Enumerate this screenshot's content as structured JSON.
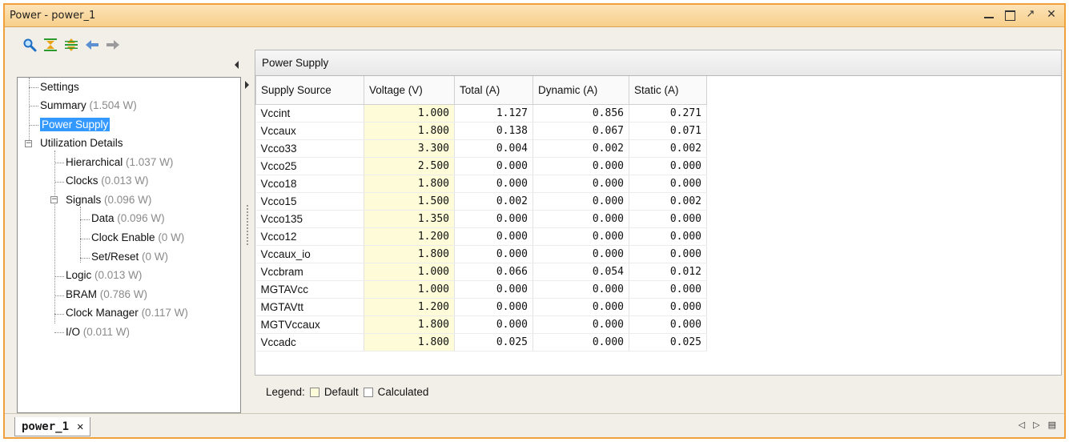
{
  "window": {
    "title": "Power - power_1",
    "minimize": "_",
    "float": "↗",
    "close": "✕"
  },
  "toolbar": {
    "icons": [
      "search-icon",
      "collapse-all-icon",
      "expand-all-icon",
      "back-arrow-icon",
      "forward-arrow-icon"
    ]
  },
  "tree": {
    "settings": "Settings",
    "summary": "Summary",
    "summary_val": "(1.504 W)",
    "power_supply": "Power Supply",
    "utilization": "Utilization Details",
    "hierarchical": "Hierarchical",
    "hierarchical_val": "(1.037 W)",
    "clocks": "Clocks",
    "clocks_val": "(0.013 W)",
    "signals": "Signals",
    "signals_val": "(0.096 W)",
    "data": "Data",
    "data_val": "(0.096 W)",
    "clock_enable": "Clock Enable",
    "clock_enable_val": "(0 W)",
    "set_reset": "Set/Reset",
    "set_reset_val": "(0 W)",
    "logic": "Logic",
    "logic_val": "(0.013 W)",
    "bram": "BRAM",
    "bram_val": "(0.786 W)",
    "clock_manager": "Clock Manager",
    "clock_manager_val": "(0.117 W)",
    "io": "I/O",
    "io_val": "(0.011 W)"
  },
  "panel": {
    "title": "Power Supply",
    "columns": [
      "Supply Source",
      "Voltage (V)",
      "Total (A)",
      "Dynamic (A)",
      "Static (A)"
    ],
    "rows": [
      [
        "Vccint",
        "1.000",
        "1.127",
        "0.856",
        "0.271"
      ],
      [
        "Vccaux",
        "1.800",
        "0.138",
        "0.067",
        "0.071"
      ],
      [
        "Vcco33",
        "3.300",
        "0.004",
        "0.002",
        "0.002"
      ],
      [
        "Vcco25",
        "2.500",
        "0.000",
        "0.000",
        "0.000"
      ],
      [
        "Vcco18",
        "1.800",
        "0.000",
        "0.000",
        "0.000"
      ],
      [
        "Vcco15",
        "1.500",
        "0.002",
        "0.000",
        "0.002"
      ],
      [
        "Vcco135",
        "1.350",
        "0.000",
        "0.000",
        "0.000"
      ],
      [
        "Vcco12",
        "1.200",
        "0.000",
        "0.000",
        "0.000"
      ],
      [
        "Vccaux_io",
        "1.800",
        "0.000",
        "0.000",
        "0.000"
      ],
      [
        "Vccbram",
        "1.000",
        "0.066",
        "0.054",
        "0.012"
      ],
      [
        "MGTAVcc",
        "1.000",
        "0.000",
        "0.000",
        "0.000"
      ],
      [
        "MGTAVtt",
        "1.200",
        "0.000",
        "0.000",
        "0.000"
      ],
      [
        "MGTVccaux",
        "1.800",
        "0.000",
        "0.000",
        "0.000"
      ],
      [
        "Vccadc",
        "1.800",
        "0.025",
        "0.000",
        "0.025"
      ]
    ],
    "legend_label": "Legend:",
    "legend_default": "Default",
    "legend_calculated": "Calculated",
    "default_color": "#fdfbd8",
    "calculated_color": "#ffffff"
  },
  "tabs": {
    "active": "power_1",
    "close": "✕"
  },
  "nav": {
    "prev": "◁",
    "next": "▷",
    "menu": "▤"
  }
}
